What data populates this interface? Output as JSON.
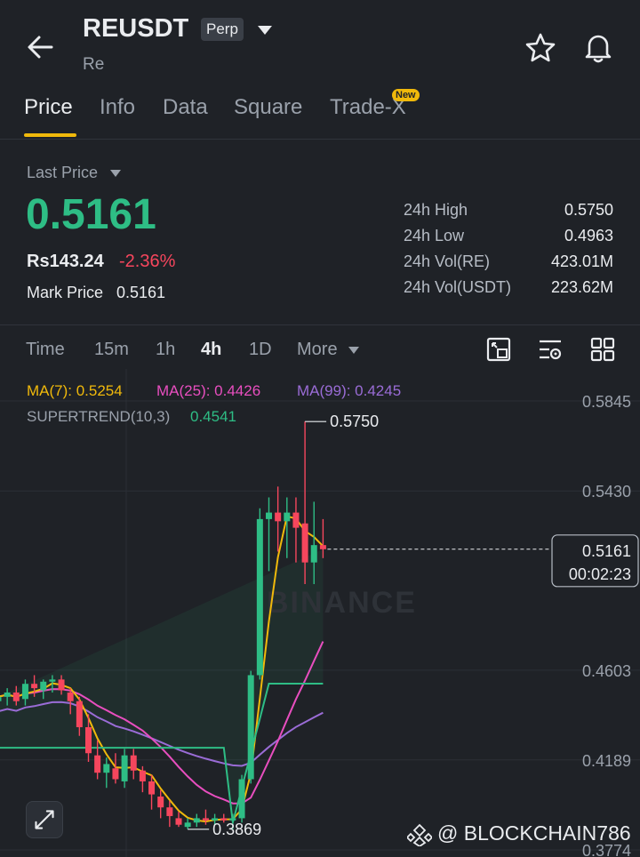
{
  "header": {
    "symbol": "REUSDT",
    "badge": "Perp",
    "subtitle": "Re"
  },
  "tabs": [
    {
      "label": "Price"
    },
    {
      "label": "Info"
    },
    {
      "label": "Data"
    },
    {
      "label": "Square"
    },
    {
      "label": "Trade-X"
    }
  ],
  "new_badge": "New",
  "ticker": {
    "last_price_label": "Last Price",
    "last_price": "0.5161",
    "local_price": "Rs143.24",
    "change": "-2.36%",
    "mark_label": "Mark Price",
    "mark_value": "0.5161",
    "stats": [
      {
        "label": "24h High",
        "value": "0.5750"
      },
      {
        "label": "24h Low",
        "value": "0.4963"
      },
      {
        "label": "24h Vol(RE)",
        "value": "423.01M"
      },
      {
        "label": "24h Vol(USDT)",
        "value": "223.62M"
      }
    ]
  },
  "timeframes": [
    "Time",
    "15m",
    "1h",
    "4h",
    "1D",
    "More"
  ],
  "active_timeframe": "4h",
  "indicators": {
    "ma7": "MA(7): 0.5254",
    "ma25": "MA(25): 0.4426",
    "ma99": "MA(99): 0.4245",
    "supertrend_label": "SUPERTREND(10,3)",
    "supertrend_value": "0.4541"
  },
  "colors": {
    "up": "#2ebd85",
    "down": "#f6465d",
    "accent": "#f0b90b",
    "ma7": "#f0b90b",
    "ma25": "#e84ebf",
    "ma99": "#9a6cd6"
  },
  "chart_data": {
    "type": "candlestick",
    "y_ticks": [
      "0.5845",
      "0.5430",
      "0.4603",
      "0.4189",
      "0.3774"
    ],
    "ylim": [
      0.3774,
      0.5845
    ],
    "high_label": "0.5750",
    "low_label": "0.3869",
    "current_price": "0.5161",
    "countdown": "00:02:23",
    "watermark": "BINANCE",
    "candles": [
      {
        "o": 0.446,
        "h": 0.45,
        "l": 0.443,
        "c": 0.448
      },
      {
        "o": 0.448,
        "h": 0.452,
        "l": 0.444,
        "c": 0.45
      },
      {
        "o": 0.45,
        "h": 0.453,
        "l": 0.444,
        "c": 0.446
      },
      {
        "o": 0.447,
        "h": 0.456,
        "l": 0.444,
        "c": 0.454
      },
      {
        "o": 0.454,
        "h": 0.458,
        "l": 0.448,
        "c": 0.452
      },
      {
        "o": 0.451,
        "h": 0.456,
        "l": 0.447,
        "c": 0.455
      },
      {
        "o": 0.455,
        "h": 0.458,
        "l": 0.45,
        "c": 0.456
      },
      {
        "o": 0.456,
        "h": 0.458,
        "l": 0.449,
        "c": 0.451
      },
      {
        "o": 0.45,
        "h": 0.452,
        "l": 0.44,
        "c": 0.446
      },
      {
        "o": 0.446,
        "h": 0.448,
        "l": 0.43,
        "c": 0.434
      },
      {
        "o": 0.434,
        "h": 0.44,
        "l": 0.418,
        "c": 0.422
      },
      {
        "o": 0.421,
        "h": 0.428,
        "l": 0.41,
        "c": 0.413
      },
      {
        "o": 0.413,
        "h": 0.42,
        "l": 0.406,
        "c": 0.417
      },
      {
        "o": 0.415,
        "h": 0.422,
        "l": 0.408,
        "c": 0.41
      },
      {
        "o": 0.409,
        "h": 0.424,
        "l": 0.406,
        "c": 0.421
      },
      {
        "o": 0.421,
        "h": 0.424,
        "l": 0.41,
        "c": 0.414
      },
      {
        "o": 0.414,
        "h": 0.416,
        "l": 0.404,
        "c": 0.409
      },
      {
        "o": 0.409,
        "h": 0.412,
        "l": 0.396,
        "c": 0.403
      },
      {
        "o": 0.402,
        "h": 0.405,
        "l": 0.392,
        "c": 0.397
      },
      {
        "o": 0.397,
        "h": 0.4,
        "l": 0.388,
        "c": 0.393
      },
      {
        "o": 0.392,
        "h": 0.395,
        "l": 0.388,
        "c": 0.389
      },
      {
        "o": 0.388,
        "h": 0.392,
        "l": 0.387,
        "c": 0.39
      },
      {
        "o": 0.39,
        "h": 0.394,
        "l": 0.388,
        "c": 0.392
      },
      {
        "o": 0.392,
        "h": 0.396,
        "l": 0.389,
        "c": 0.391
      },
      {
        "o": 0.391,
        "h": 0.394,
        "l": 0.389,
        "c": 0.392
      },
      {
        "o": 0.392,
        "h": 0.394,
        "l": 0.39,
        "c": 0.391
      },
      {
        "o": 0.391,
        "h": 0.394,
        "l": 0.387,
        "c": 0.392
      },
      {
        "o": 0.392,
        "h": 0.412,
        "l": 0.39,
        "c": 0.41
      },
      {
        "o": 0.41,
        "h": 0.46,
        "l": 0.408,
        "c": 0.458
      },
      {
        "o": 0.458,
        "h": 0.535,
        "l": 0.456,
        "c": 0.53
      },
      {
        "o": 0.53,
        "h": 0.54,
        "l": 0.506,
        "c": 0.533
      },
      {
        "o": 0.533,
        "h": 0.545,
        "l": 0.515,
        "c": 0.529
      },
      {
        "o": 0.529,
        "h": 0.54,
        "l": 0.512,
        "c": 0.533
      },
      {
        "o": 0.533,
        "h": 0.54,
        "l": 0.51,
        "c": 0.526
      },
      {
        "o": 0.528,
        "h": 0.575,
        "l": 0.5,
        "c": 0.51
      },
      {
        "o": 0.51,
        "h": 0.538,
        "l": 0.5,
        "c": 0.518
      },
      {
        "o": 0.518,
        "h": 0.53,
        "l": 0.512,
        "c": 0.5161
      }
    ]
  },
  "watermark_handle": "@ BLOCKCHAIN786"
}
